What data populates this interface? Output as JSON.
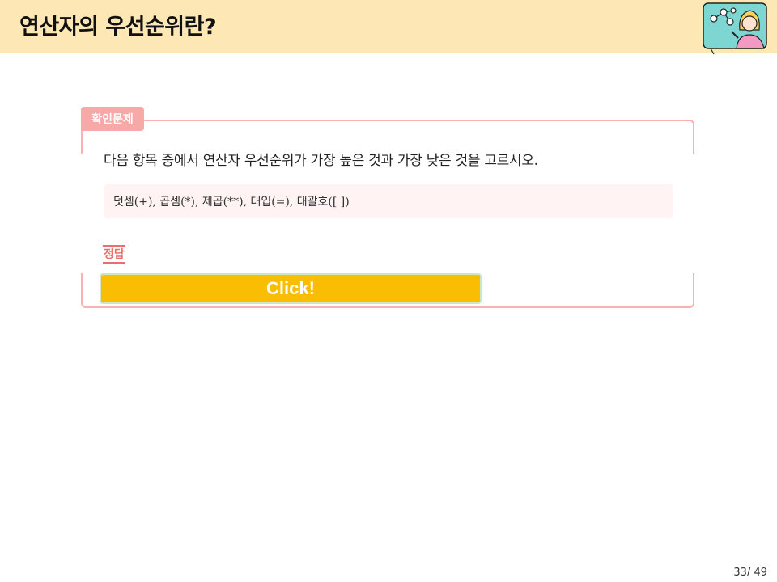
{
  "header": {
    "title": "연산자의 우선순위란?"
  },
  "quiz": {
    "badge": "확인문제",
    "question": "다음 항목 중에서 연산자 우선순위가 가장 높은 것과 가장 낮은 것을 고르시오.",
    "items": "덧셈(+), 곱셈(*), 제곱(**), 대입(=), 대괄호([ ])",
    "answer_label": "정답",
    "reveal_button": "Click!"
  },
  "footer": {
    "page_number": "33/ 49"
  },
  "colors": {
    "header_bg": "#fde7b4",
    "badge_bg": "#f7a9a7",
    "border": "#f7b2b2",
    "button_bg": "#f9be03"
  }
}
